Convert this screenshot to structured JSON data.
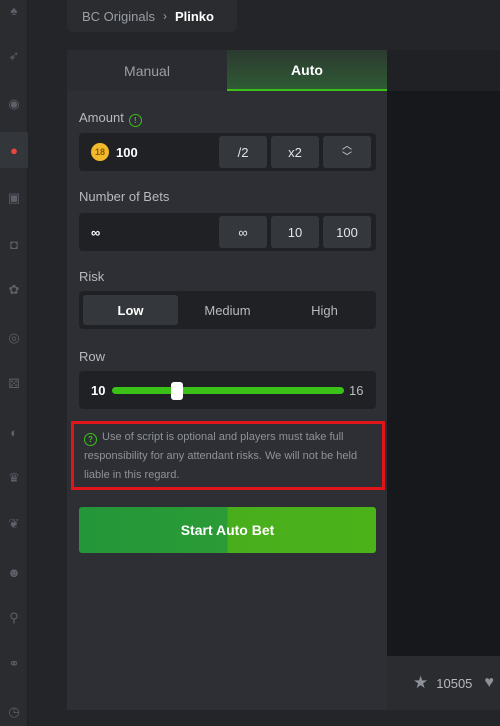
{
  "breadcrumb": {
    "parent": "BC Originals",
    "current": "Plinko"
  },
  "tabs": [
    {
      "label": "Manual",
      "active": false
    },
    {
      "label": "Auto",
      "active": true
    }
  ],
  "amount": {
    "label": "Amount",
    "coin_symbol": "18",
    "value": "100",
    "half_label": "/2",
    "double_label": "x2"
  },
  "bets": {
    "label": "Number of Bets",
    "value": "∞",
    "options": [
      "∞",
      "10",
      "100"
    ]
  },
  "risk": {
    "label": "Risk",
    "options": [
      "Low",
      "Medium",
      "High"
    ],
    "selected": "Low"
  },
  "row": {
    "label": "Row",
    "min": "10",
    "max": "16",
    "fraction": 0.27
  },
  "warning": {
    "text": "Use of script is optional and players must take full responsibility for any attendant risks. We will not be held liable in this regard."
  },
  "start_button": {
    "label": "Start Auto Bet"
  },
  "footer": {
    "favorites_count": "10505"
  },
  "colors": {
    "accent_green": "#3bc117",
    "warning_border": "#e0141b",
    "panel_bg": "#2d2f34",
    "field_bg": "#1f2124"
  },
  "sidebar_icons": [
    "spade-icon",
    "rocket-icon",
    "roulette-icon",
    "plinko-icon",
    "slot-icon",
    "box-icon",
    "poker-chip-icon",
    "target-icon",
    "dice-icon",
    "ball-icon",
    "crown-icon",
    "fruit-icon",
    "mask-icon",
    "lamp-icon",
    "coin-flip-icon",
    "clock-icon"
  ]
}
